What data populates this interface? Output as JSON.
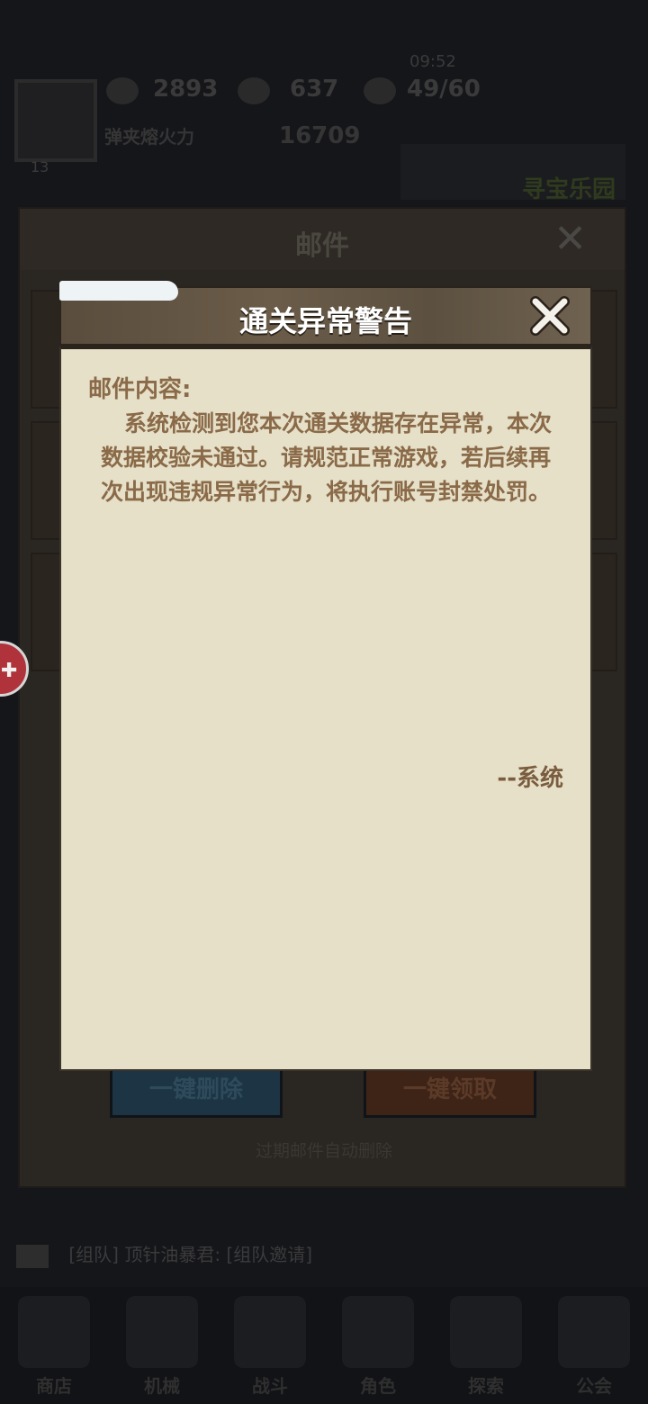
{
  "status": {
    "time": "09:52"
  },
  "hud": {
    "level": "13",
    "gold": "2893",
    "gems": "637",
    "energy": "49/60",
    "player_name": "弹夹熔火力",
    "power": "16709",
    "event_label": "寻宝乐园"
  },
  "mail_panel": {
    "title": "邮件",
    "delete_all_label": "一键删除",
    "claim_all_label": "一键领取",
    "expire_note": "过期邮件自动删除"
  },
  "chat": {
    "message": "[组队] 顶针油暴君: [组队邀请]"
  },
  "bottom_nav": [
    {
      "label": "商店",
      "icon": "shop-icon"
    },
    {
      "label": "机械",
      "icon": "mech-icon"
    },
    {
      "label": "战斗",
      "icon": "battle-icon"
    },
    {
      "label": "角色",
      "icon": "character-icon"
    },
    {
      "label": "探索",
      "icon": "explore-icon"
    },
    {
      "label": "公会",
      "icon": "guild-icon"
    }
  ],
  "dialog": {
    "title": "通关异常警告",
    "content_label": "邮件内容:",
    "content": "系统检测到您本次通关数据存在异常，本次数据校验未通过。请规范正常游戏，若后续再次出现违规异常行为，将执行账号封禁处罚。",
    "signature": "--系统"
  },
  "colors": {
    "dialog_text": "#8a6a48",
    "dialog_body": "#e6e0c9",
    "dialog_header": "#5e5140"
  }
}
